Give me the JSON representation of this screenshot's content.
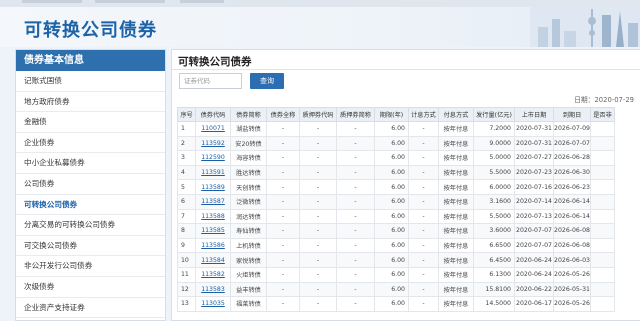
{
  "banner": {
    "title": "可转换公司债券"
  },
  "sidebar": {
    "heading": "债券基本信息",
    "items": [
      {
        "label": "记账式国债",
        "active": false
      },
      {
        "label": "地方政府债券",
        "active": false
      },
      {
        "label": "金融债",
        "active": false
      },
      {
        "label": "企业债券",
        "active": false
      },
      {
        "label": "中小企业私募债券",
        "active": false
      },
      {
        "label": "公司债券",
        "active": false
      },
      {
        "label": "可转换公司债券",
        "active": true
      },
      {
        "label": "分离交易的可转换公司债券",
        "active": false
      },
      {
        "label": "可交换公司债券",
        "active": false
      },
      {
        "label": "非公开发行公司债券",
        "active": false
      },
      {
        "label": "次级债券",
        "active": false
      },
      {
        "label": "企业资产支持证券",
        "active": false
      }
    ]
  },
  "main": {
    "title": "可转换公司债券",
    "search_placeholder": "证券代码",
    "search_button": "查询",
    "date_label": "日期：2020-07-29"
  },
  "table": {
    "headers": [
      "序号",
      "债券代码",
      "债券简称",
      "债券全称",
      "质押券代码",
      "质押券简称",
      "期限(年)",
      "计息方式",
      "付息方式",
      "发行量(亿元)",
      "上市日期",
      "到期日",
      "是否非"
    ],
    "rows": [
      [
        "1",
        "110071",
        "湖盐转债",
        "-",
        "-",
        "-",
        "6.00",
        "-",
        "按年付息",
        "7.2000",
        "2020-07-31",
        "2026-07-09",
        ""
      ],
      [
        "2",
        "113592",
        "安20转债",
        "-",
        "-",
        "-",
        "6.00",
        "-",
        "按年付息",
        "9.0000",
        "2020-07-31",
        "2026-07-07",
        ""
      ],
      [
        "3",
        "112590",
        "海容转债",
        "-",
        "-",
        "-",
        "6.00",
        "-",
        "按年付息",
        "5.0000",
        "2020-07-27",
        "2026-06-28",
        ""
      ],
      [
        "4",
        "113591",
        "胜达转债",
        "-",
        "-",
        "-",
        "6.00",
        "-",
        "按年付息",
        "5.5000",
        "2020-07-23",
        "2026-06-30",
        ""
      ],
      [
        "5",
        "113589",
        "天创转债",
        "-",
        "-",
        "-",
        "6.00",
        "-",
        "按年付息",
        "6.0000",
        "2020-07-16",
        "2026-06-23",
        ""
      ],
      [
        "6",
        "113587",
        "泛微转债",
        "-",
        "-",
        "-",
        "6.00",
        "-",
        "按年付息",
        "3.1600",
        "2020-07-14",
        "2026-06-14",
        ""
      ],
      [
        "7",
        "113588",
        "润达转债",
        "-",
        "-",
        "-",
        "6.00",
        "-",
        "按年付息",
        "5.5000",
        "2020-07-13",
        "2026-06-14",
        ""
      ],
      [
        "8",
        "113585",
        "寿仙转债",
        "-",
        "-",
        "-",
        "6.00",
        "-",
        "按年付息",
        "3.6000",
        "2020-07-07",
        "2026-06-08",
        ""
      ],
      [
        "9",
        "113586",
        "上机转债",
        "-",
        "-",
        "-",
        "6.00",
        "-",
        "按年付息",
        "6.6500",
        "2020-07-07",
        "2026-06-08",
        ""
      ],
      [
        "10",
        "113584",
        "家悦转债",
        "-",
        "-",
        "-",
        "6.00",
        "-",
        "按年付息",
        "6.4500",
        "2020-06-24",
        "2026-06-03",
        ""
      ],
      [
        "11",
        "113582",
        "火炬转债",
        "-",
        "-",
        "-",
        "6.00",
        "-",
        "按年付息",
        "6.1300",
        "2020-06-24",
        "2026-05-26",
        ""
      ],
      [
        "12",
        "113583",
        "益丰转债",
        "-",
        "-",
        "-",
        "6.00",
        "-",
        "按年付息",
        "15.8100",
        "2020-06-22",
        "2026-05-31",
        ""
      ],
      [
        "13",
        "113035",
        "福莱转债",
        "-",
        "-",
        "-",
        "6.00",
        "-",
        "按年付息",
        "14.5000",
        "2020-06-17",
        "2026-05-26",
        ""
      ]
    ]
  },
  "colors": {
    "brand": "#1c63a8",
    "sidebar_head": "#2e6fae",
    "link": "#1a5fa8"
  }
}
